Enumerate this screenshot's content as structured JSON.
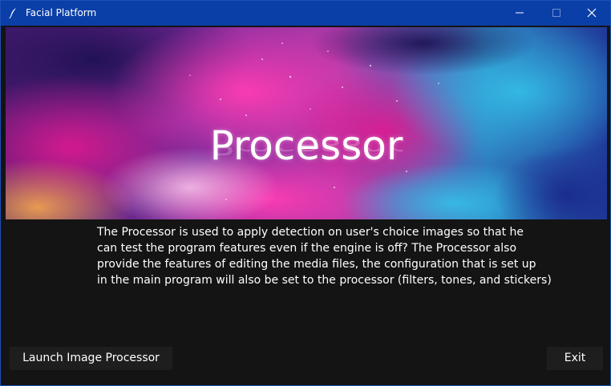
{
  "window": {
    "title": "Facial Platform",
    "icon": "feather-icon",
    "controls": [
      "minimize-icon",
      "maximize-icon",
      "close-icon"
    ]
  },
  "banner": {
    "title": "Processor",
    "colors": [
      "#3a1a6e",
      "#e0228c",
      "#ff5fd0",
      "#2aa6d8",
      "#1b2a8a",
      "#ffb04a"
    ]
  },
  "description": {
    "lines": [
      "The Processor is used to apply detection on user's choice images so that he",
      "can test the program features even if the engine is off? The Processor also",
      "provide the features of editing the media files, the configuration that is set up",
      "in the main program will also be set to the processor (filters, tones, and stickers)"
    ]
  },
  "buttons": {
    "launch_label": "Launch Image Processor",
    "exit_label": "Exit"
  },
  "theme": {
    "titlebar": "#0b3fa8",
    "background": "#141414",
    "button_bg": "#1e1e1e",
    "text": "#ffffff"
  }
}
